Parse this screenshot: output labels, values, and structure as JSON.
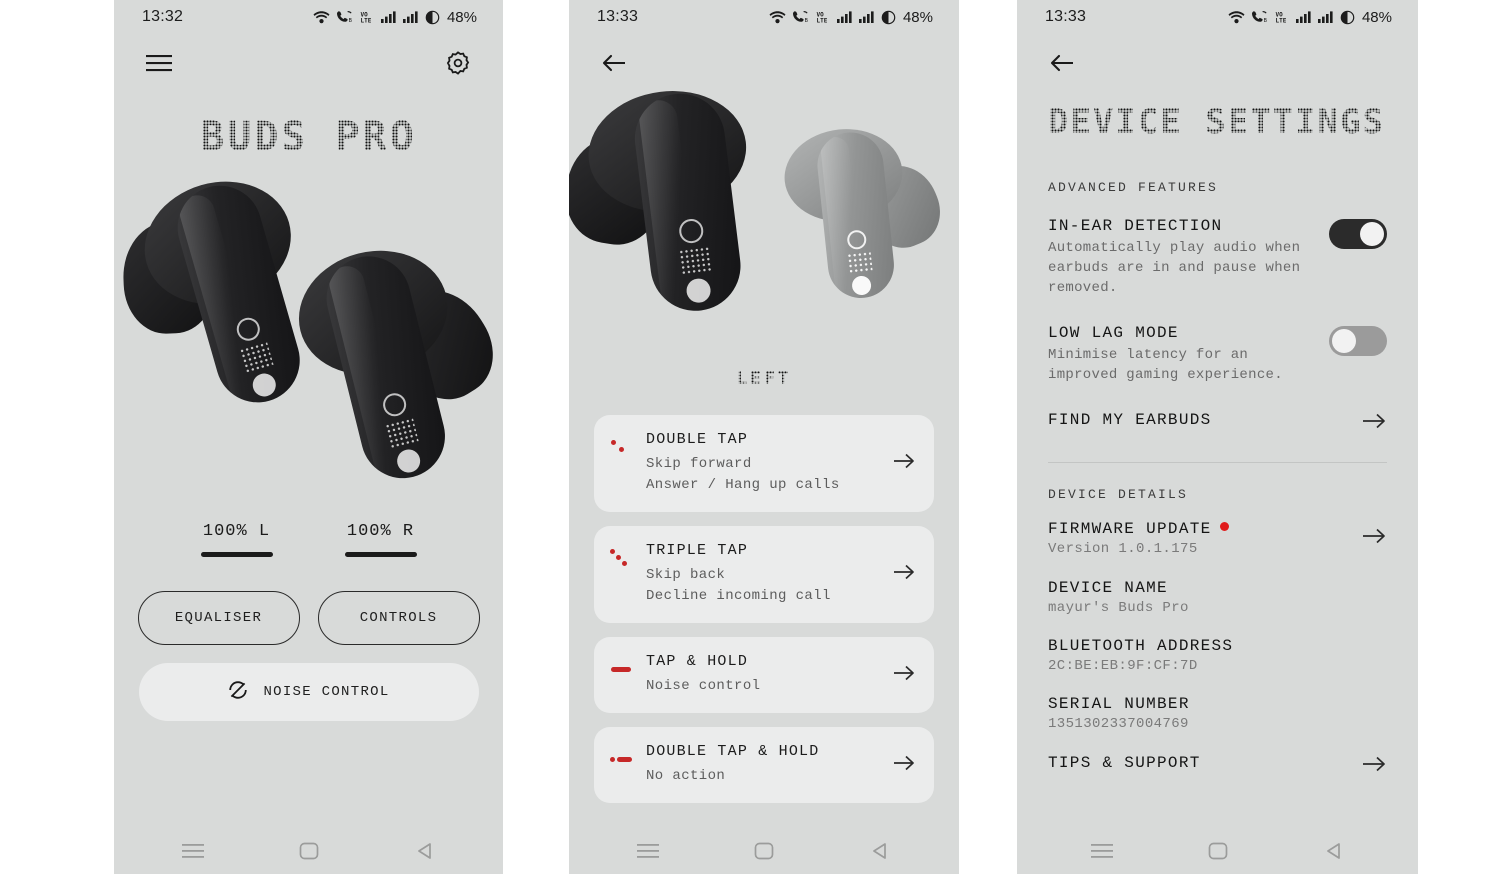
{
  "panel1": {
    "statusbar": {
      "time": "13:32",
      "battery": "48%",
      "icons": [
        "wifi-icon",
        "vowifi-call-icon",
        "volte-icon",
        "signal-bars-icon",
        "signal-bars-icon",
        "battery-circle-icon"
      ]
    },
    "menu_icon": "hamburger-menu-icon",
    "settings_icon": "gear-icon",
    "title": "BUDS PRO",
    "battery_left": {
      "value": "100% L"
    },
    "battery_right": {
      "value": "100% R"
    },
    "buttons": {
      "equaliser": "EQUALISER",
      "controls": "CONTROLS",
      "noise_control": "NOISE CONTROL"
    },
    "noise_icon": "noise-cancel-off-icon"
  },
  "panel2": {
    "statusbar": {
      "time": "13:33",
      "battery": "48%"
    },
    "back_icon": "back-arrow-icon",
    "selected_earbud": "LEFT",
    "gestures": [
      {
        "icon": "double-tap-icon",
        "title": "DOUBLE TAP",
        "lines": [
          "Skip forward",
          "Answer / Hang up calls"
        ]
      },
      {
        "icon": "triple-tap-icon",
        "title": "TRIPLE TAP",
        "lines": [
          "Skip back",
          "Decline incoming call"
        ]
      },
      {
        "icon": "tap-hold-icon",
        "title": "TAP & HOLD",
        "lines": [
          "Noise control"
        ]
      },
      {
        "icon": "double-tap-hold-icon",
        "title": "DOUBLE TAP & HOLD",
        "lines": [
          "No action"
        ]
      }
    ]
  },
  "panel3": {
    "statusbar": {
      "time": "13:33",
      "battery": "48%"
    },
    "back_icon": "back-arrow-icon",
    "title": "DEVICE SETTINGS",
    "section_advanced": "ADVANCED FEATURES",
    "in_ear": {
      "title": "IN-EAR DETECTION",
      "desc": "Automatically play audio when earbuds are in and pause when removed.",
      "toggle": "on"
    },
    "low_lag": {
      "title": "LOW LAG MODE",
      "desc": "Minimise latency for an improved gaming experience.",
      "toggle": "off"
    },
    "find_my_earbuds": "FIND MY EARBUDS",
    "section_details": "DEVICE DETAILS",
    "firmware": {
      "title": "FIRMWARE UPDATE",
      "value": "Version 1.0.1.175",
      "badge": "red-dot"
    },
    "device_name": {
      "title": "DEVICE NAME",
      "value": "mayur's Buds Pro"
    },
    "bluetooth": {
      "title": "BLUETOOTH ADDRESS",
      "value": "2C:BE:EB:9F:CF:7D"
    },
    "serial": {
      "title": "SERIAL NUMBER",
      "value": "1351302337004769"
    },
    "tips": {
      "title": "TIPS & SUPPORT"
    }
  },
  "navbar": {
    "recents": "recents-icon",
    "home": "home-icon",
    "back": "back-nav-icon"
  },
  "colors": {
    "screen_bg": "#d8dad9",
    "card_bg": "#ebecec",
    "accent_red": "#c62828",
    "badge_red": "#e01b1b",
    "toggle_on": "#2b2b2b",
    "toggle_off": "#9b9b9b"
  }
}
